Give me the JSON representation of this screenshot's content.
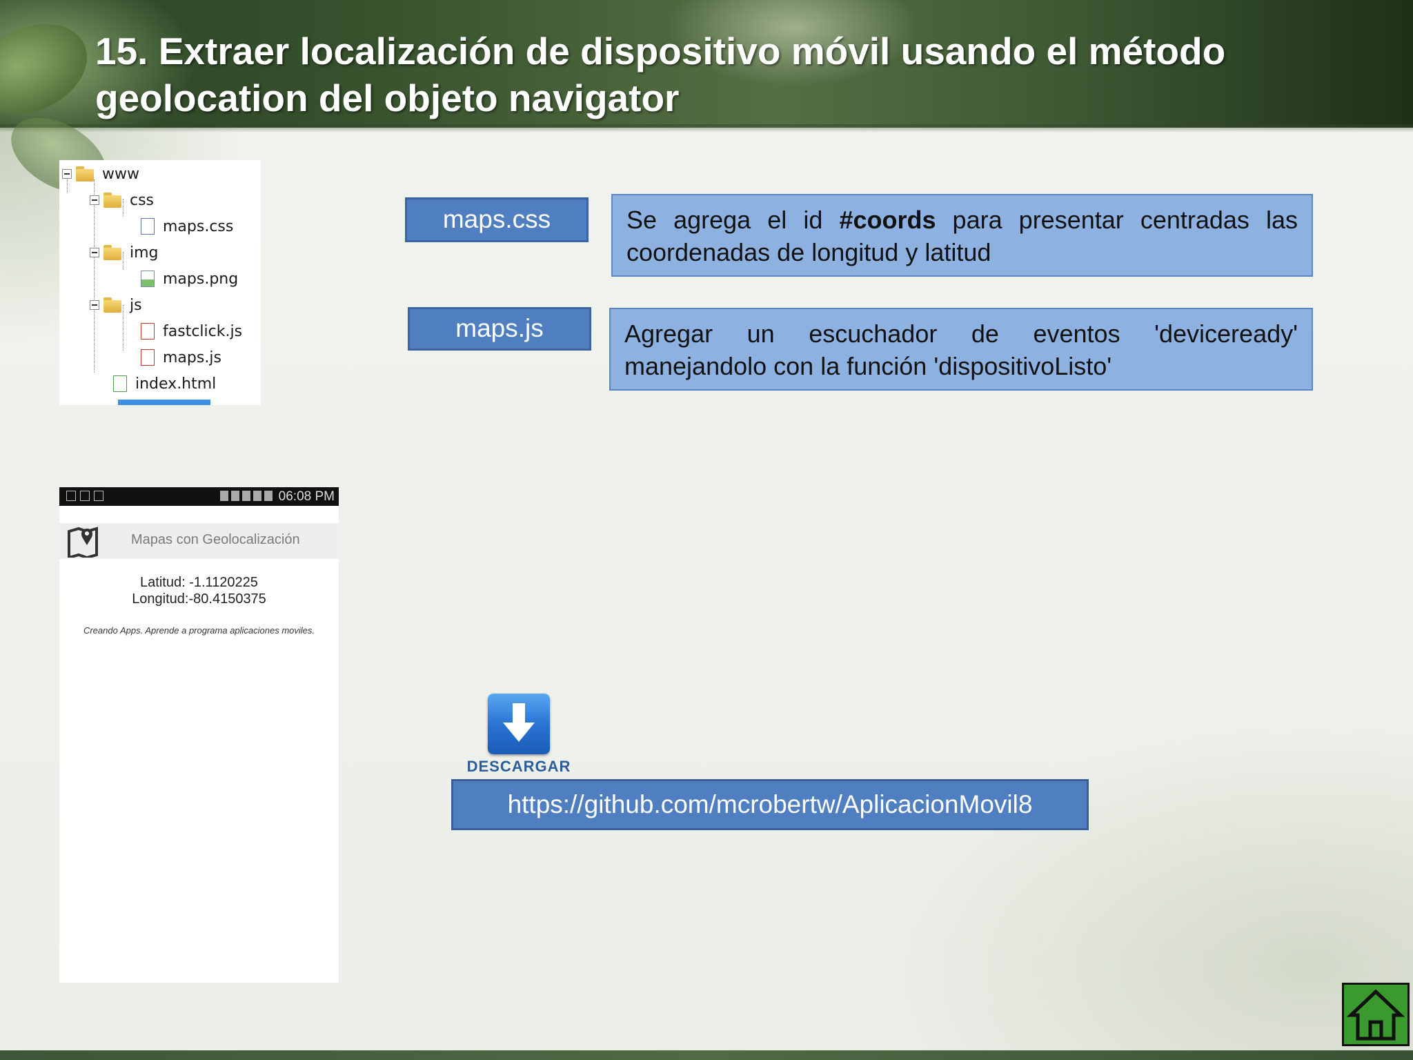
{
  "slide": {
    "title": "15. Extraer localización de dispositivo móvil usando el método geolocation del objeto navigator"
  },
  "file_tree": {
    "items": [
      {
        "label": "www",
        "type": "folder"
      },
      {
        "label": "css",
        "type": "folder"
      },
      {
        "label": "maps.css",
        "type": "file"
      },
      {
        "label": "img",
        "type": "folder"
      },
      {
        "label": "maps.png",
        "type": "file"
      },
      {
        "label": "js",
        "type": "folder"
      },
      {
        "label": "fastclick.js",
        "type": "file"
      },
      {
        "label": "maps.js",
        "type": "file"
      },
      {
        "label": "index.html",
        "type": "file"
      }
    ]
  },
  "labels": {
    "css_file": "maps.css",
    "js_file": "maps.js"
  },
  "callouts": {
    "css_pre": "Se agrega el id ",
    "css_bold": "#coords",
    "css_post": " para presentar centradas las coordenadas de longitud y latitud",
    "js_text": "Agregar un escuchador de eventos 'deviceready' manejandolo con la función 'dispositivoListo'"
  },
  "phone": {
    "status_time": "06:08 PM",
    "app_title": "Mapas con Geolocalización",
    "latitude": "Latitud: -1.1120225",
    "longitude": "Longitud:-80.4150375",
    "tagline": "Creando Apps. Aprende a programa aplicaciones moviles."
  },
  "download": {
    "label": "DESCARGAR",
    "url": "https://github.com/mcrobertw/AplicacionMovil8"
  },
  "colors": {
    "header_green": "#36512c",
    "label_blue": "#4f7fc0",
    "callout_blue": "#8db2e2",
    "home_green": "#3a9a2e"
  },
  "icons": [
    "folder-icon",
    "file-icon",
    "map-icon",
    "download-arrow-icon",
    "home-icon"
  ]
}
